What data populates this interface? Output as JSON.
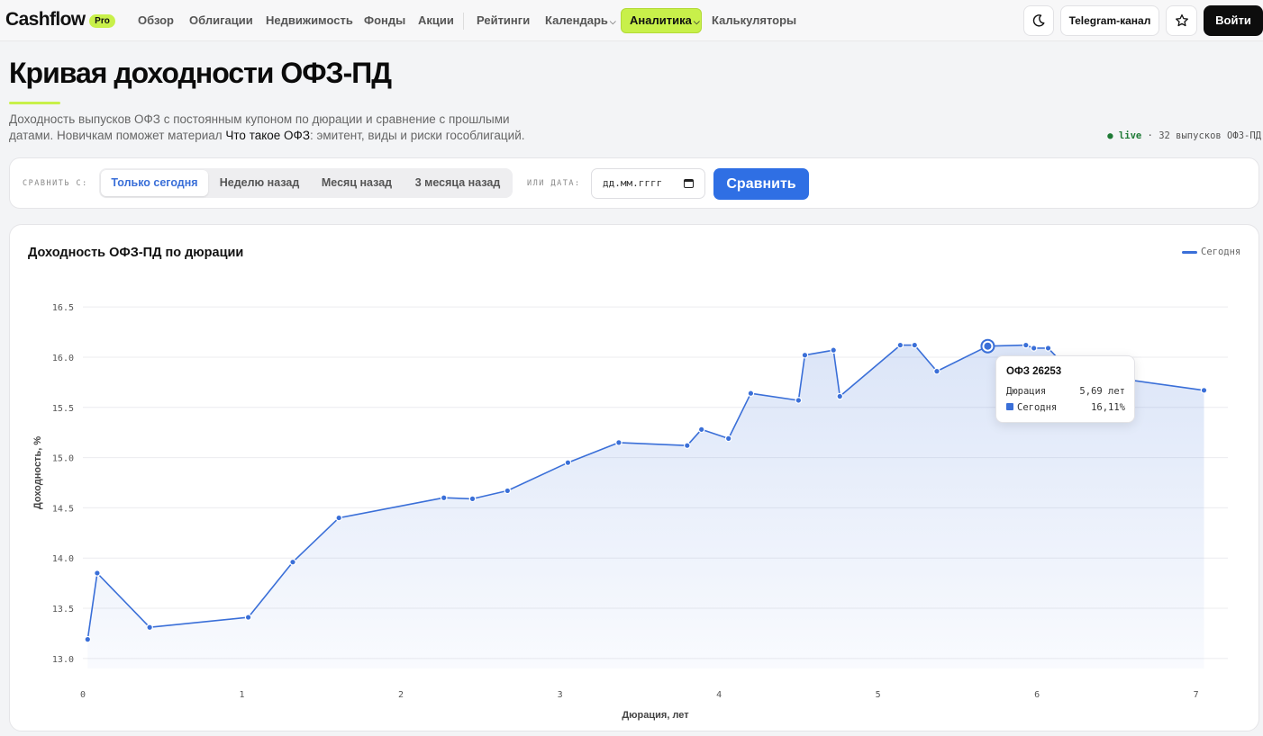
{
  "header": {
    "logo": "Cashflow",
    "badge": "Pro",
    "nav": [
      {
        "label": "Обзор"
      },
      {
        "label": "Облигации"
      },
      {
        "label": "Недвижимость"
      },
      {
        "label": "Фонды"
      },
      {
        "label": "Акции"
      },
      {
        "label": "Рейтинги"
      },
      {
        "label": "Календарь"
      },
      {
        "label": "Аналитика"
      },
      {
        "label": "Калькуляторы"
      }
    ],
    "telegram_label": "Telegram-канал",
    "login_label": "Войти",
    "theme_icon": "moon-icon",
    "favorite_icon": "star-icon"
  },
  "intro": {
    "title": "Кривая доходности ОФЗ-ПД",
    "description_pre": "Доходность выпусков ОФЗ с постоянным купоном по дюрации и сравнение с прошлыми датами. Новичкам поможет материал ",
    "link_text": "Что такое ОФЗ",
    "description_post": ": эмитент, виды и риски гособлигаций.",
    "live_label": "● live",
    "live_separator": "·",
    "issues_count_text": "32 выпусков ОФЗ-ПД"
  },
  "compare": {
    "label": "СРАВНИТЬ С:",
    "options": [
      "Только сегодня",
      "Неделю назад",
      "Месяц назад",
      "3 месяца назад"
    ],
    "active_option": "Только сегодня",
    "date_label": "ИЛИ ДАТА:",
    "date_placeholder": "дд.мм.гггг",
    "submit_label": "Сравнить"
  },
  "chart_data": {
    "type": "line",
    "title": "Доходность ОФЗ-ПД по дюрации",
    "xlabel": "Дюрация, лет",
    "ylabel": "Доходность, %",
    "xlim": [
      0,
      7.2
    ],
    "ylim": [
      12.9,
      16.6
    ],
    "x_ticks": [
      0,
      1,
      2,
      3,
      4,
      5,
      6,
      7
    ],
    "y_ticks": [
      13.0,
      13.5,
      14.0,
      14.5,
      15.0,
      15.5,
      16.0,
      16.5
    ],
    "grid": true,
    "legend_position": "top-right",
    "colors": {
      "line": "#3a6fd8"
    },
    "series": [
      {
        "name": "Сегодня",
        "points": [
          [
            0.03,
            13.19
          ],
          [
            0.09,
            13.85
          ],
          [
            0.42,
            13.31
          ],
          [
            1.04,
            13.41
          ],
          [
            1.32,
            13.96
          ],
          [
            1.61,
            14.4
          ],
          [
            2.27,
            14.6
          ],
          [
            2.45,
            14.59
          ],
          [
            2.67,
            14.67
          ],
          [
            3.05,
            14.95
          ],
          [
            3.37,
            15.15
          ],
          [
            3.8,
            15.12
          ],
          [
            3.89,
            15.28
          ],
          [
            4.06,
            15.19
          ],
          [
            4.2,
            15.64
          ],
          [
            4.5,
            15.57
          ],
          [
            4.54,
            16.02
          ],
          [
            4.72,
            16.07
          ],
          [
            4.76,
            15.61
          ],
          [
            5.14,
            16.12
          ],
          [
            5.23,
            16.12
          ],
          [
            5.37,
            15.86
          ],
          [
            5.69,
            16.11
          ],
          [
            5.93,
            16.12
          ],
          [
            5.98,
            16.09
          ],
          [
            6.07,
            16.09
          ],
          [
            6.21,
            15.86
          ],
          [
            6.55,
            15.78
          ],
          [
            7.05,
            15.67
          ]
        ]
      }
    ],
    "tooltip": {
      "title": "ОФЗ 26253",
      "duration_label": "Дюрация",
      "duration_value": "5,69 лет",
      "series_label": "Сегодня",
      "yield_value": "16,11%",
      "x": 5.69,
      "y": 16.11
    }
  }
}
